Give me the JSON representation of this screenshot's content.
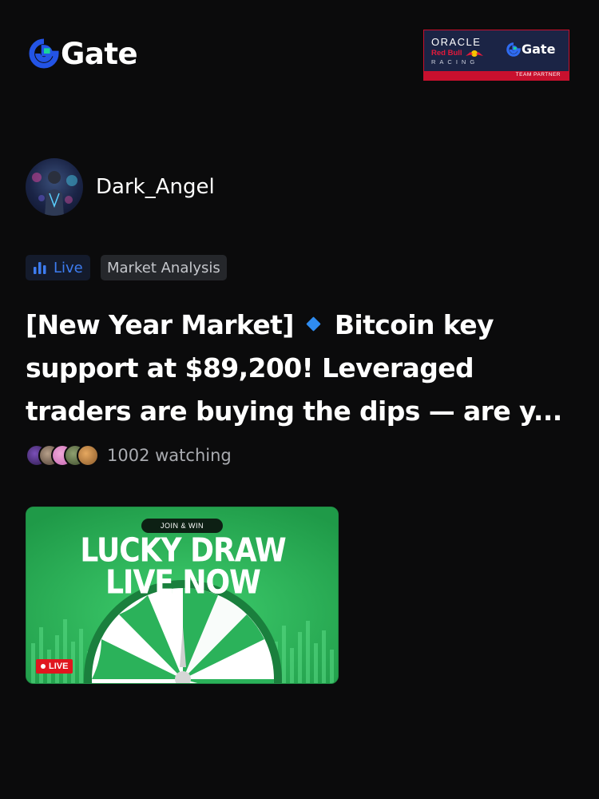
{
  "header": {
    "logo_text": "Gate",
    "logo_icon": "gate-logo-icon",
    "partner": {
      "oracle": "ORACLE",
      "redbull": "Red Bull",
      "racing": "RACING",
      "gate": "Gate",
      "team_partner": "TEAM PARTNER"
    }
  },
  "host": {
    "name": "Dark_Angel"
  },
  "tags": {
    "live_label": "Live",
    "category": "Market Analysis"
  },
  "stream": {
    "title_part1": "[New Year Market]",
    "title_part2": "Bitcoin key support at $89,200! Leveraged traders are buying the dips — are y...",
    "watching": "1002 watching"
  },
  "thumbnail": {
    "pill": "JOIN & WIN",
    "headline1": "LUCKY DRAW",
    "headline2": "LIVE NOW",
    "live_badge": "LIVE"
  },
  "colors": {
    "background": "#0b0b0c",
    "accent_blue": "#3d7cf0",
    "thumbnail_green": "#29b257",
    "live_red": "#e0161e"
  }
}
